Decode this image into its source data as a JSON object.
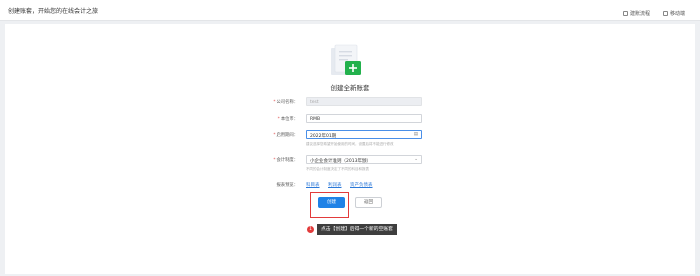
{
  "header": {
    "title": "创建账套，开始您的在线会计之旅",
    "options": [
      {
        "label": "建账流程"
      },
      {
        "label": "移动端"
      }
    ]
  },
  "form": {
    "heading": "创建全新账套",
    "company_name": {
      "label": "公司名称：",
      "value": "test"
    },
    "currency": {
      "label": "本位币：",
      "value": "RMB"
    },
    "start_period": {
      "label": "启用期间：",
      "value": "2022年01期",
      "hint": "建议选择您希望开始使用的时间，设置后将不能进行修改"
    },
    "accounting_system": {
      "label": "会计制度：",
      "value": "小企业会计准则（2013年颁）",
      "hint": "不同的会计制度决定了不同的科目和报表"
    },
    "quick_preview": {
      "label": "报表预览：",
      "links": [
        "科目表",
        "利润表",
        "资产负债表"
      ]
    },
    "buttons": {
      "create": "创建",
      "back": "返回"
    }
  },
  "tooltip": {
    "number": "1",
    "text": "点击【创建】后得一个新的空账套"
  },
  "colors": {
    "primary": "#1f82e6",
    "highlight": "#e23b3b",
    "icon_green": "#22b14c"
  }
}
